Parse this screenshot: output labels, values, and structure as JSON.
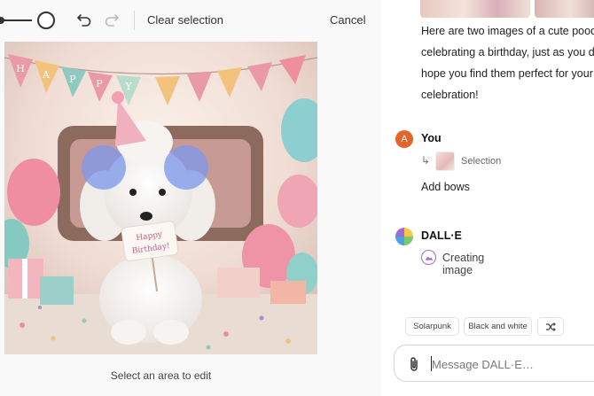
{
  "editor": {
    "toolbar": {
      "clear_selection_label": "Clear selection",
      "cancel_label": "Cancel",
      "undo_icon": "undo-icon",
      "redo_icon": "redo-icon"
    },
    "image": {
      "banner_letters": [
        "H",
        "A",
        "P",
        "P",
        "Y",
        "",
        "",
        "",
        "",
        "",
        "",
        ""
      ],
      "sign_text_line1": "Happy",
      "sign_text_line2": "Birthday!"
    },
    "hint": "Select an area to edit"
  },
  "chat": {
    "assistant_paragraph": [
      "Here are two images of a cute poodle",
      "celebrating a birthday, just as you de",
      "hope you find them perfect for your",
      "celebration!"
    ],
    "user": {
      "avatar_letter": "A",
      "name": "You",
      "selection_label": "Selection",
      "message": "Add bows"
    },
    "assistant": {
      "name": "DALL·E",
      "status": "Creating image"
    },
    "suggestions": [
      "Solarpunk",
      "Black and white"
    ],
    "shuffle_icon": "shuffle-icon",
    "composer": {
      "placeholder": "Message DALL·E…",
      "attach_icon": "paperclip-icon"
    }
  },
  "colors": {
    "accent_user": "#e2652a",
    "selection_blue": "#7f99ea",
    "creating_purple": "#a06ad6"
  }
}
